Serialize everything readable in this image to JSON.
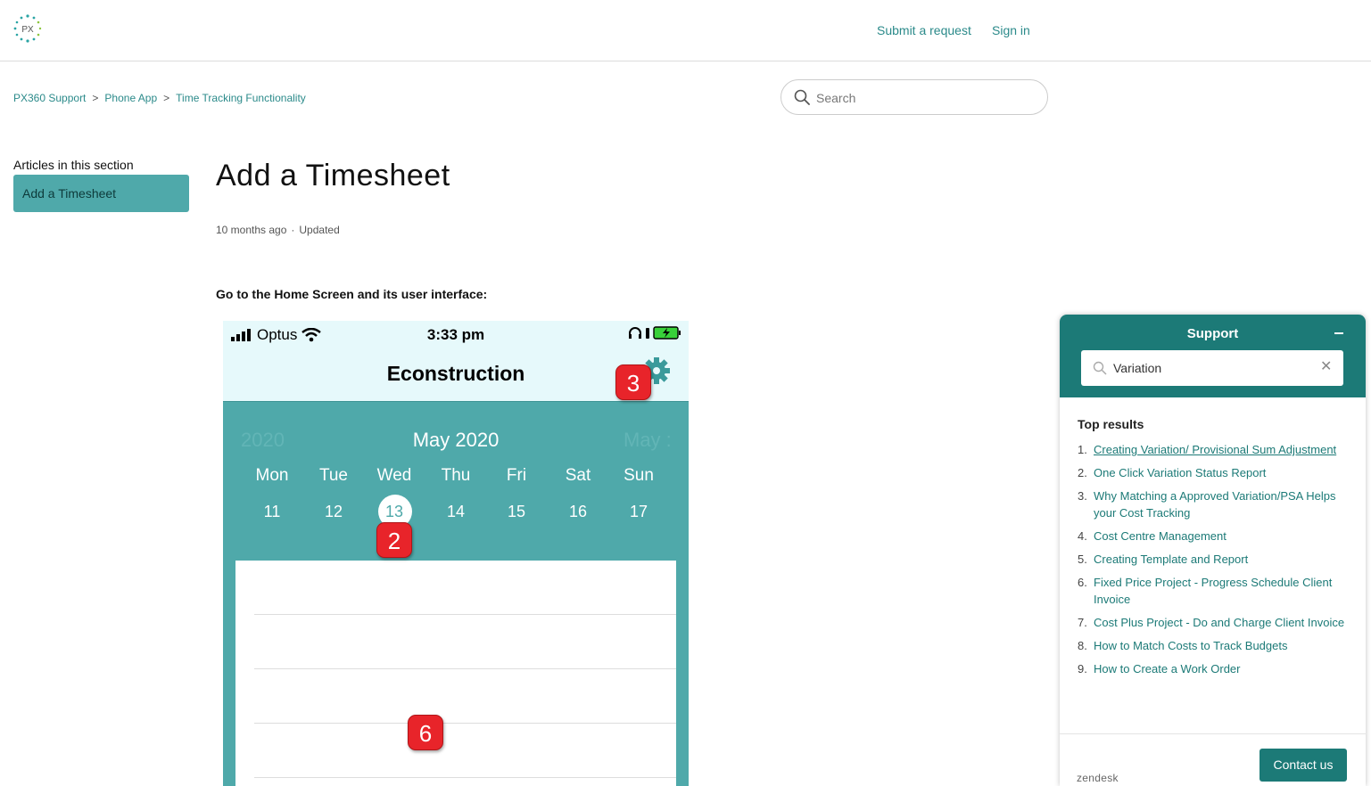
{
  "header": {
    "logo_text": "PX",
    "submit_request": "Submit a request",
    "sign_in": "Sign in"
  },
  "breadcrumb": [
    "PX360 Support",
    "Phone App",
    "Time Tracking Functionality"
  ],
  "breadcrumb_separator": ">",
  "search": {
    "placeholder": "Search",
    "icon": "search-icon"
  },
  "sidebar": {
    "title": "Articles in this section",
    "items": [
      {
        "label": "Add a Timesheet",
        "active": true
      }
    ]
  },
  "article": {
    "title": "Add a Timesheet",
    "age": "10 months ago",
    "meta_separator": "·",
    "updated": "Updated",
    "intro": "Go to the Home Screen and its user interface:"
  },
  "phone": {
    "carrier": "Optus",
    "time": "3:33 pm",
    "app_title": "Econstruction",
    "settings_icon": "gear-icon",
    "calendar": {
      "prev_label": "2020",
      "current": "May 2020",
      "next_label": "May :",
      "days": [
        {
          "name": "Mon",
          "num": "11"
        },
        {
          "name": "Tue",
          "num": "12"
        },
        {
          "name": "Wed",
          "num": "13"
        },
        {
          "name": "Thu",
          "num": "14"
        },
        {
          "name": "Fri",
          "num": "15"
        },
        {
          "name": "Sat",
          "num": "16"
        },
        {
          "name": "Sun",
          "num": "17"
        }
      ],
      "selected_day": "13"
    },
    "annotations": [
      "3",
      "2",
      "6"
    ]
  },
  "widget": {
    "title": "Support",
    "search_value": "Variation",
    "top_results_label": "Top results",
    "results": [
      "Creating Variation/ Provisional Sum Adjustment",
      "One Click Variation Status Report",
      "Why Matching a Approved Variation/PSA Helps your Cost Tracking",
      "Cost Centre Management",
      "Creating Template and Report",
      "Fixed Price Project - Progress Schedule Client Invoice",
      "Cost Plus Project - Do and Charge Client Invoice",
      "How to Match Costs to Track Budgets",
      "How to Create a Work Order"
    ],
    "brand": "zendesk",
    "contact_button": "Contact us"
  },
  "colors": {
    "accent": "#2b8a8a",
    "teal_calendar": "#4fa9aa",
    "widget_header": "#1c7a77",
    "badge_red": "#e8242a",
    "phone_header_bg": "#e6f9fb"
  }
}
